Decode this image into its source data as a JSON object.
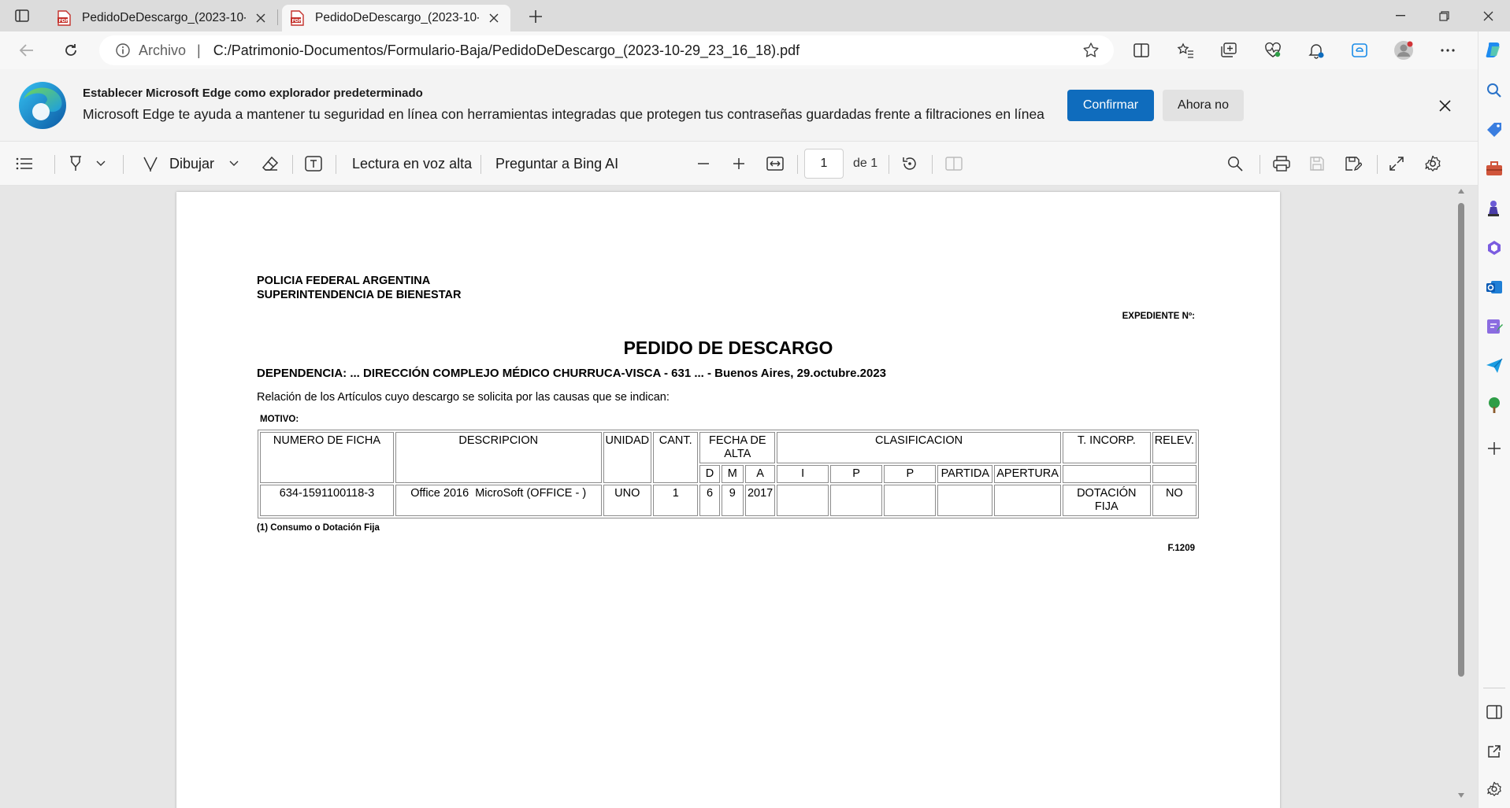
{
  "tabs": [
    {
      "title": "PedidoDeDescargo_(2023-10-29_23_16_18).pdf",
      "icon": "pdf-file-icon",
      "active": false
    },
    {
      "title": "PedidoDeDescargo_(2023-10-29_23_16_18).pdf",
      "icon": "pdf-file-icon",
      "active": true
    }
  ],
  "address": {
    "scheme_label": "Archivo",
    "separator": "|",
    "url": "C:/Patrimonio-Documentos/Formulario-Baja/PedidoDeDescargo_(2023-10-29_23_16_18).pdf"
  },
  "infobar": {
    "title": "Establecer Microsoft Edge como explorador predeterminado",
    "text": "Microsoft Edge te ayuda a mantener tu seguridad en línea con herramientas integradas que protegen tus contraseñas guardadas frente a filtraciones en línea",
    "confirm_label": "Confirmar",
    "later_label": "Ahora no"
  },
  "pdf_toolbar": {
    "draw_label": "Dibujar",
    "read_aloud_label": "Lectura en voz alta",
    "ask_bing_label": "Preguntar a Bing AI",
    "current_page": "1",
    "page_total_label": "de 1"
  },
  "document": {
    "org_line1": "POLICIA FEDERAL ARGENTINA",
    "org_line2": "SUPERINTENDENCIA DE BIENESTAR",
    "expediente_label": "EXPEDIENTE Nº:",
    "title": "PEDIDO DE DESCARGO",
    "dependencia": "DEPENDENCIA: ... DIRECCIÓN COMPLEJO MÉDICO CHURRUCA-VISCA - 631 ... - Buenos Aires, 29.octubre.2023",
    "relacion": "Relación de los Artículos cuyo descargo se solicita por las causas que se indican:",
    "motivo_label": "MOTIVO:",
    "table": {
      "headers": {
        "numero_ficha": "NUMERO DE FICHA",
        "descripcion": "DESCRIPCION",
        "unidad": "UNIDAD",
        "cant": "CANT.",
        "fecha_alta": "FECHA DE ALTA",
        "clasificacion": "CLASIFICACION",
        "t_incorp": "T. INCORP.",
        "relev": "RELEV."
      },
      "subheaders": {
        "d": "D",
        "m": "M",
        "a": "A",
        "i": "I",
        "p1": "P",
        "p2": "P",
        "partida": "PARTIDA",
        "apertura": "APERTURA"
      },
      "rows": [
        {
          "numero_ficha": "634-1591100118-3",
          "descripcion": "Office 2016  MicroSoft (OFFICE - )",
          "unidad": "UNO",
          "cant": "1",
          "d": "6",
          "m": "9",
          "a": "2017",
          "i": "",
          "p1": "",
          "p2": "",
          "partida": "",
          "apertura": "",
          "t_incorp": "DOTACIÓN FIJA",
          "relev": "NO"
        }
      ]
    },
    "footnote": "(1) Consumo o Dotación Fija",
    "form_code": "F.1209"
  },
  "colors": {
    "accent": "#0f6cbd",
    "tabstrip": "#dcdcdc",
    "viewer_bg": "#e6e6e6"
  }
}
